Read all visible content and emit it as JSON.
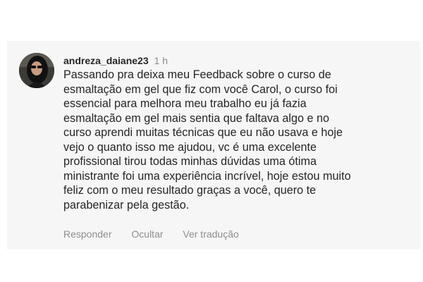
{
  "comment": {
    "avatar_icon": "user-avatar-photo",
    "username": "andreza_daiane23",
    "time": "1 h",
    "text": "Passando pra deixa meu Feedback sobre o curso de\nesmaltação em gel que fiz com você Carol, o curso foi\nessencial para melhora meu trabalho eu já fazia\nesmaltação em gel mais sentia que faltava algo e no\ncurso aprendi muitas técnicas que eu não usava e hoje\nvejo o quanto isso me ajudou, vc é uma excelente\nprofissional tirou todas minhas dúvidas uma ótima\nministrante foi uma experiência incrível, hoje estou muito\nfeliz com o meu resultado graças a você, quero te\nparabenizar pela gestão.",
    "actions": {
      "reply": "Responder",
      "hide": "Ocultar",
      "translate": "Ver tradução"
    }
  }
}
